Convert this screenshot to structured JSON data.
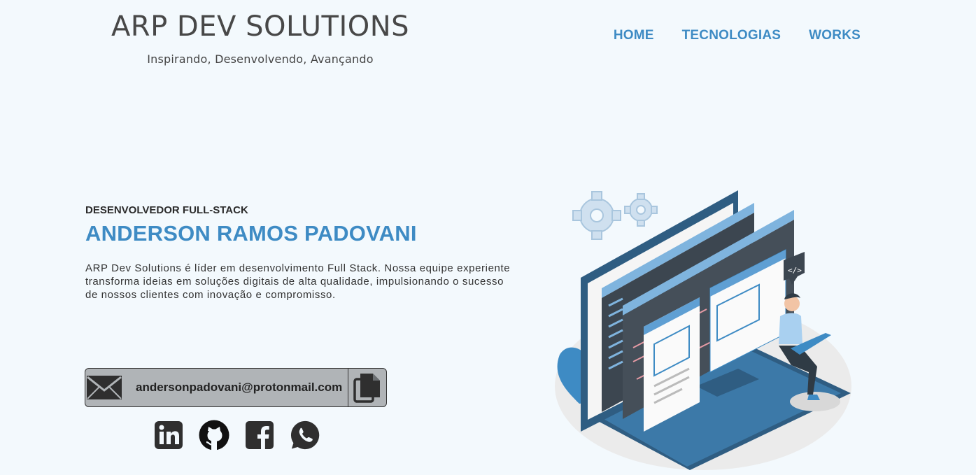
{
  "header": {
    "brand_title": "ARP DEV SOLUTIONS",
    "brand_tagline": "Inspirando, Desenvolvendo, Avançando",
    "nav": [
      {
        "label": "HOME"
      },
      {
        "label": "TECNOLOGIAS"
      },
      {
        "label": "WORKS"
      }
    ]
  },
  "hero": {
    "role": "DESENVOLVEDOR FULL-STACK",
    "name": "ANDERSON RAMOS PADOVANI",
    "description": "ARP Dev Solutions é líder em desenvolvimento Full Stack. Nossa equipe experiente transforma ideias em soluções digitais de alta qualidade, impulsionando o sucesso de nossos clientes com inovação e compromisso."
  },
  "contact": {
    "email": "andersonpadovani@protonmail.com",
    "email_icon": "envelope-icon",
    "copy_icon": "copy-icon"
  },
  "socials": [
    {
      "icon": "linkedin-icon"
    },
    {
      "icon": "github-icon"
    },
    {
      "icon": "facebook-icon"
    },
    {
      "icon": "whatsapp-icon"
    }
  ],
  "colors": {
    "background": "#f3f9fd",
    "accent": "#3e8bc4",
    "text_dark": "#2b2b2b",
    "email_box": "#b0b4b7"
  }
}
